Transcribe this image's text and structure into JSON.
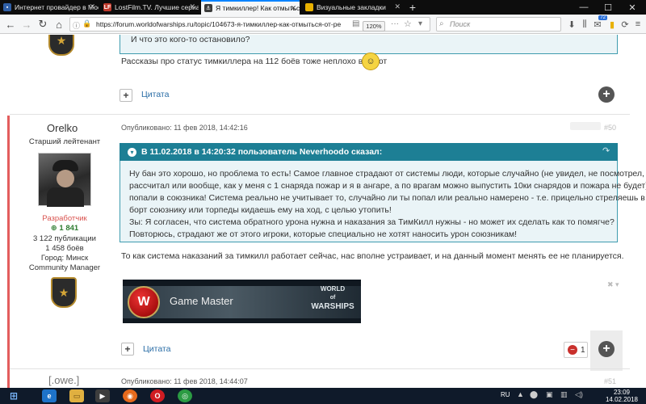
{
  "browser": {
    "tabs": [
      {
        "title": "Интернет провайдер в Москв",
        "icon_color": "#2f5fa7",
        "icon": "folder-icon"
      },
      {
        "title": "LostFilm.TV. Лучшие сериал",
        "icon_color": "#c0392b",
        "icon_text": "LF"
      },
      {
        "title": "Я тимкиллер! Как отмыться от",
        "icon_color": "#3b3b3b",
        "icon": "wows-icon"
      },
      {
        "title": "Визуальные закладки",
        "icon_color": "#e8b100",
        "icon": "yandex-icon"
      }
    ],
    "url": "https://forum.worldofwarships.ru/topic/104673-я-тимкиллер-как-отмыться-от-ре",
    "zoom": "120%",
    "search_placeholder": "Поиск",
    "notification_count": "72"
  },
  "post_prev": {
    "quote_tail": "И что это кого-то остановило?",
    "text": "Рассказы про статус тимкиллера на 112 боёв тоже неплохо влияют",
    "cite_label": "Цитата"
  },
  "post": {
    "author": "Orelko",
    "rank": "Старший лейтенант",
    "role": "Разработчик",
    "reputation": "1 841",
    "publications": "3 122 публикации",
    "battles": "1 458 боёв",
    "city": "Город: Минск",
    "title2": "Community Manager",
    "posted": "Опубликовано: 11 фев 2018, 14:42:16",
    "number": "#50",
    "quote_header": "В 11.02.2018 в 14:20:32 пользователь Neverhoodo сказал:",
    "quote_lines": [
      "Ну бан это хорошо, но проблема то есть! Самое главное страдают от системы люди, которые случайно (не увидел, не посмотрел, не",
      "рассчитал или вообще, как у меня с 1 снаряда пожар и я в ангаре, а по врагам можно выпустить 10ки снарядов и пожара не будет)",
      "попали в союзника! Система реально не учитывает то, случайно ли ты попал или реально намерено - т.е. прицельно стреляешь в",
      "борт союзнику или торпеды кидаешь ему на ход, с целью утопить!",
      "Зы: Я согласен, что система обратного урона нужна и наказания за ТимКилл нужны - но может их сделать как то помягче?",
      "Повторюсь, страдают же от этого игроки, которые специально не  хотят наносить урон союзникам!"
    ],
    "reply": "То как система наказаний за тимкилл работает сейчас, нас вполне устраивает, и на данный момент менять ее не планируется.",
    "banner_title": "Game Master",
    "banner_logo_top": "WORLD",
    "banner_logo_mid": "of",
    "banner_logo_bottom": "WARSHIPS",
    "cite_label": "Цитата",
    "reaction_count": "1"
  },
  "post_next": {
    "author": "[.owe.]",
    "posted": "Опубликовано: 11 фев 2018, 14:44:07",
    "number": "#51"
  },
  "taskbar": {
    "lang": "RU",
    "time": "23:09",
    "date": "14.02.2018"
  },
  "colors": {
    "accent_teal": "#1d7f95",
    "developer_red": "#d9534f",
    "stripe_red": "#e35d5d"
  }
}
